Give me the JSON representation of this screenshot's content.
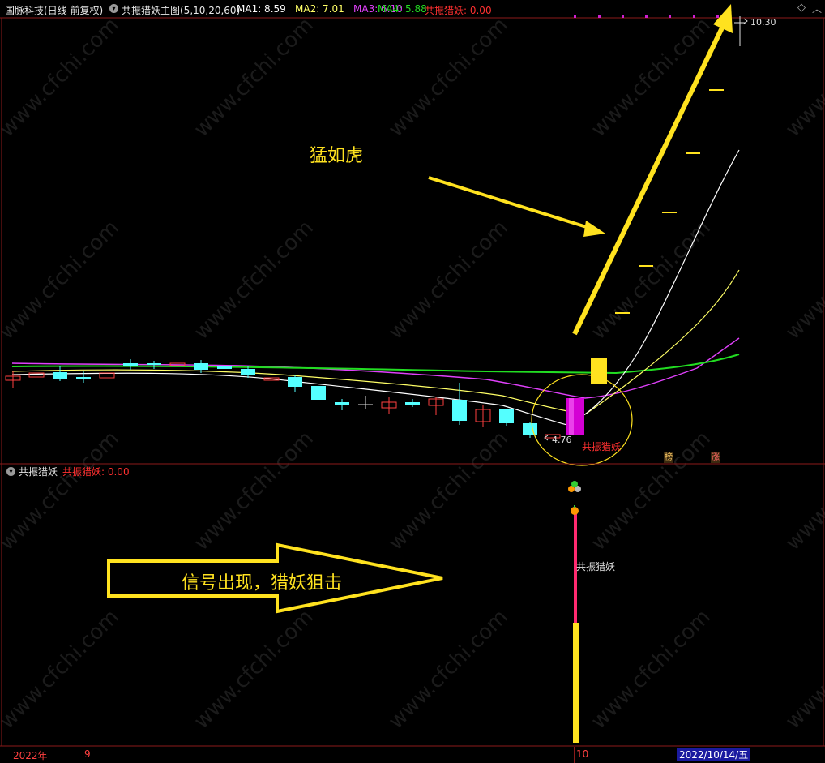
{
  "header": {
    "stock_title": "国脉科技(日线 前复权)",
    "indicator_title": "共振猎妖主图(5,10,20,60)",
    "ma1": "MA1: 8.59",
    "ma2": "MA2: 7.01",
    "ma3": "MA3: 6.10",
    "ma4": "MA4: 5.88",
    "signal": "共振猎妖: 0.00"
  },
  "colors": {
    "ma1": "#ffffff",
    "ma2": "#ffff66",
    "ma3": "#e040fb",
    "ma4": "#22dd22",
    "signal": "#ff3030",
    "annotation": "#ffe21f",
    "up_candle": "#ff4040",
    "down_candle": "#54ffff"
  },
  "main_chart": {
    "price_high_label": "10.30",
    "price_low_label": "4.76",
    "annotation_tiger": "猛如虎",
    "signal_label": "共振猎妖",
    "badge_list": "榜",
    "badge_limit": "涨"
  },
  "sub_chart": {
    "title": "共振猎妖",
    "value": "共振猎妖: 0.00",
    "bar_label": "共振猎妖",
    "annotation_signal": "信号出现，猎妖狙击"
  },
  "date_axis": {
    "year": "2022年",
    "month_9": "9",
    "month_10": "10",
    "current_date": "2022/10/14/五"
  },
  "watermark": "www.cfchi.com"
}
